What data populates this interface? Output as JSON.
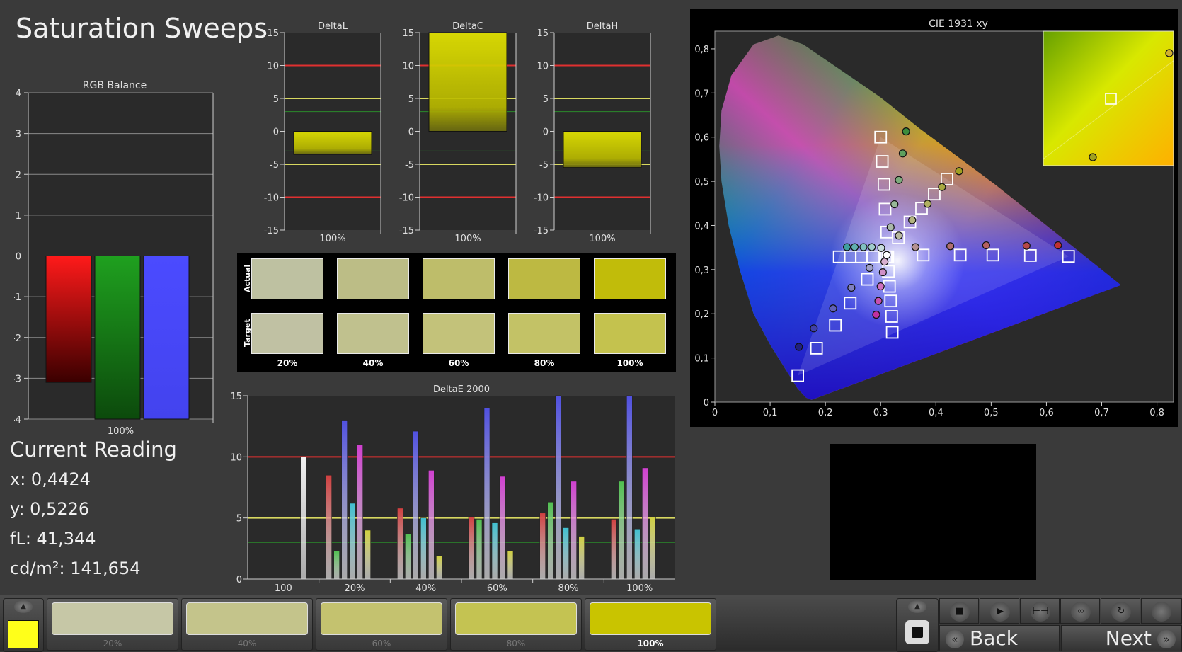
{
  "title": "Saturation Sweeps",
  "current_reading": {
    "heading": "Current Reading",
    "x": "x: 0,4424",
    "y": "y: 0,5226",
    "fl": "fL: 41,344",
    "cdm2": "cd/m²: 141,654"
  },
  "swatch_panel": {
    "actual_label": "Actual",
    "target_label": "Target",
    "columns": [
      {
        "label": "20%",
        "actual": "#bec1a1",
        "target": "#c0c1a3"
      },
      {
        "label": "40%",
        "actual": "#bcbd86",
        "target": "#c0c18e"
      },
      {
        "label": "60%",
        "actual": "#bebd6a",
        "target": "#c3c27a"
      },
      {
        "label": "80%",
        "actual": "#bdb942",
        "target": "#c3c266"
      },
      {
        "label": "100%",
        "actual": "#c1bc0a",
        "target": "#c4c24e"
      }
    ]
  },
  "bottom_bar": {
    "current_color": "#ffff1a",
    "steps": [
      {
        "label": "20%",
        "color": "#c6c7a6"
      },
      {
        "label": "40%",
        "color": "#c4c48b"
      },
      {
        "label": "60%",
        "color": "#c4c26f"
      },
      {
        "label": "80%",
        "color": "#c4c352"
      },
      {
        "label": "100%",
        "color": "#c9c400",
        "active": true
      }
    ],
    "back_label": "Back",
    "next_label": "Next",
    "icons": [
      "stop-icon",
      "play-icon",
      "range-icon",
      "infinity-icon",
      "refresh-icon",
      "record-icon"
    ]
  },
  "chart_data": [
    {
      "type": "bar",
      "title": "RGB Balance",
      "categories": [
        "100%"
      ],
      "series": [
        {
          "name": "",
          "color": "#ff1a1a",
          "values": [
            -3.1
          ]
        },
        {
          "name": "",
          "color": "#1f9a1f",
          "values": [
            -4.0
          ]
        },
        {
          "name": "",
          "color": "#4b4bff",
          "values": [
            -4.0
          ]
        }
      ],
      "ylim": [
        -4,
        4
      ],
      "yticks": [
        "4",
        "3",
        "2",
        "1",
        "0",
        "-1",
        "-2",
        "-3",
        "-4"
      ]
    },
    {
      "type": "bar",
      "title": "DeltaL",
      "categories": [
        "100%"
      ],
      "values": [
        -3.5
      ],
      "ylim": [
        -15,
        15
      ],
      "yticks": [
        "15",
        "10",
        "5",
        "0",
        "-5",
        "-10",
        "-15"
      ]
    },
    {
      "type": "bar",
      "title": "DeltaC",
      "categories": [
        "100%"
      ],
      "values": [
        15
      ],
      "ylim": [
        -15,
        15
      ],
      "yticks": [
        "15",
        "10",
        "5",
        "0",
        "-5",
        "-10",
        "-15"
      ]
    },
    {
      "type": "bar",
      "title": "DeltaH",
      "categories": [
        "100%"
      ],
      "values": [
        -5.5
      ],
      "ylim": [
        -15,
        15
      ],
      "yticks": [
        "15",
        "10",
        "5",
        "0",
        "-5",
        "-10",
        "-15"
      ]
    },
    {
      "type": "bar",
      "title": "DeltaE 2000",
      "categories": [
        "100",
        "20%",
        "40%",
        "60%",
        "80%",
        "100%"
      ],
      "ylim": [
        0,
        15
      ],
      "yticks": [
        "15",
        "10",
        "5",
        "0"
      ],
      "bar_colors": [
        "#d04040",
        "#50c050",
        "#5050e0",
        "#40c0d0",
        "#d040d0",
        "#d0d040",
        "#f0f0f0"
      ],
      "groups": [
        {
          "category": "100",
          "values": [
            null,
            null,
            null,
            null,
            null,
            null,
            10
          ]
        },
        {
          "category": "20%",
          "values": [
            8.5,
            2.3,
            13.0,
            6.2,
            11.0,
            4.0,
            null
          ]
        },
        {
          "category": "40%",
          "values": [
            5.8,
            3.7,
            12.1,
            5.0,
            8.9,
            1.9,
            null
          ]
        },
        {
          "category": "60%",
          "values": [
            5.1,
            4.9,
            14.0,
            4.6,
            8.4,
            2.3,
            null
          ]
        },
        {
          "category": "80%",
          "values": [
            5.4,
            6.3,
            15.0,
            4.2,
            8.0,
            3.5,
            null
          ]
        },
        {
          "category": "100%",
          "values": [
            4.9,
            8.0,
            15.0,
            4.1,
            9.1,
            5.1,
            null
          ]
        }
      ]
    },
    {
      "type": "scatter",
      "title": "CIE 1931 xy",
      "xlim": [
        0,
        0.83
      ],
      "ylim": [
        0,
        0.84
      ],
      "xticks": [
        "0",
        "0,1",
        "0,2",
        "0,3",
        "0,4",
        "0,5",
        "0,6",
        "0,7",
        "0,8"
      ],
      "yticks": [
        "0",
        "0,1",
        "0,2",
        "0,3",
        "0,4",
        "0,5",
        "0,6",
        "0,7",
        "0,8"
      ],
      "targets": [
        [
          0.3,
          0.6
        ],
        [
          0.303,
          0.545
        ],
        [
          0.306,
          0.493
        ],
        [
          0.308,
          0.437
        ],
        [
          0.311,
          0.385
        ],
        [
          0.64,
          0.33
        ],
        [
          0.571,
          0.332
        ],
        [
          0.503,
          0.333
        ],
        [
          0.444,
          0.333
        ],
        [
          0.377,
          0.333
        ],
        [
          0.15,
          0.06
        ],
        [
          0.184,
          0.122
        ],
        [
          0.218,
          0.174
        ],
        [
          0.245,
          0.224
        ],
        [
          0.276,
          0.278
        ],
        [
          0.225,
          0.329
        ],
        [
          0.245,
          0.329
        ],
        [
          0.265,
          0.329
        ],
        [
          0.287,
          0.329
        ],
        [
          0.31,
          0.329
        ],
        [
          0.321,
          0.158
        ],
        [
          0.32,
          0.194
        ],
        [
          0.318,
          0.229
        ],
        [
          0.316,
          0.262
        ],
        [
          0.314,
          0.296
        ],
        [
          0.42,
          0.505
        ],
        [
          0.397,
          0.471
        ],
        [
          0.374,
          0.439
        ],
        [
          0.353,
          0.408
        ],
        [
          0.332,
          0.372
        ],
        [
          0.313,
          0.329
        ]
      ],
      "measured": [
        {
          "xy": [
            0.346,
            0.613
          ],
          "color": "#3c8c3c"
        },
        {
          "xy": [
            0.34,
            0.563
          ],
          "color": "#5ea05e"
        },
        {
          "xy": [
            0.333,
            0.503
          ],
          "color": "#7cab7c"
        },
        {
          "xy": [
            0.325,
            0.448
          ],
          "color": "#98b898"
        },
        {
          "xy": [
            0.318,
            0.396
          ],
          "color": "#aab8aa"
        },
        {
          "xy": [
            0.621,
            0.355
          ],
          "color": "#c03030"
        },
        {
          "xy": [
            0.564,
            0.354
          ],
          "color": "#b84848"
        },
        {
          "xy": [
            0.491,
            0.355
          ],
          "color": "#b46060"
        },
        {
          "xy": [
            0.426,
            0.353
          ],
          "color": "#b07070"
        },
        {
          "xy": [
            0.363,
            0.351
          ],
          "color": "#b49090"
        },
        {
          "xy": [
            0.152,
            0.125
          ],
          "color": "#202080"
        },
        {
          "xy": [
            0.179,
            0.167
          ],
          "color": "#4040a8"
        },
        {
          "xy": [
            0.214,
            0.212
          ],
          "color": "#6060b8"
        },
        {
          "xy": [
            0.247,
            0.259
          ],
          "color": "#8080c0"
        },
        {
          "xy": [
            0.28,
            0.304
          ],
          "color": "#a0a0c8"
        },
        {
          "xy": [
            0.239,
            0.351
          ],
          "color": "#40a0a0"
        },
        {
          "xy": [
            0.253,
            0.351
          ],
          "color": "#60b0b0"
        },
        {
          "xy": [
            0.269,
            0.351
          ],
          "color": "#80c0c0"
        },
        {
          "xy": [
            0.284,
            0.351
          ],
          "color": "#a0cccc"
        },
        {
          "xy": [
            0.301,
            0.349
          ],
          "color": "#c8dcdc"
        },
        {
          "xy": [
            0.292,
            0.198
          ],
          "color": "#c030a0"
        },
        {
          "xy": [
            0.296,
            0.229
          ],
          "color": "#c850b0"
        },
        {
          "xy": [
            0.3,
            0.262
          ],
          "color": "#d070c0"
        },
        {
          "xy": [
            0.304,
            0.294
          ],
          "color": "#d090c8"
        },
        {
          "xy": [
            0.307,
            0.318
          ],
          "color": "#d8b0d0"
        },
        {
          "xy": [
            0.442,
            0.523
          ],
          "color": "#a0a020"
        },
        {
          "xy": [
            0.411,
            0.487
          ],
          "color": "#a8a840"
        },
        {
          "xy": [
            0.385,
            0.449
          ],
          "color": "#b0b060"
        },
        {
          "xy": [
            0.357,
            0.412
          ],
          "color": "#b4b480"
        },
        {
          "xy": [
            0.333,
            0.377
          ],
          "color": "#b8b8a0"
        },
        {
          "xy": [
            0.311,
            0.333
          ],
          "color": "#ffffff"
        }
      ]
    }
  ]
}
